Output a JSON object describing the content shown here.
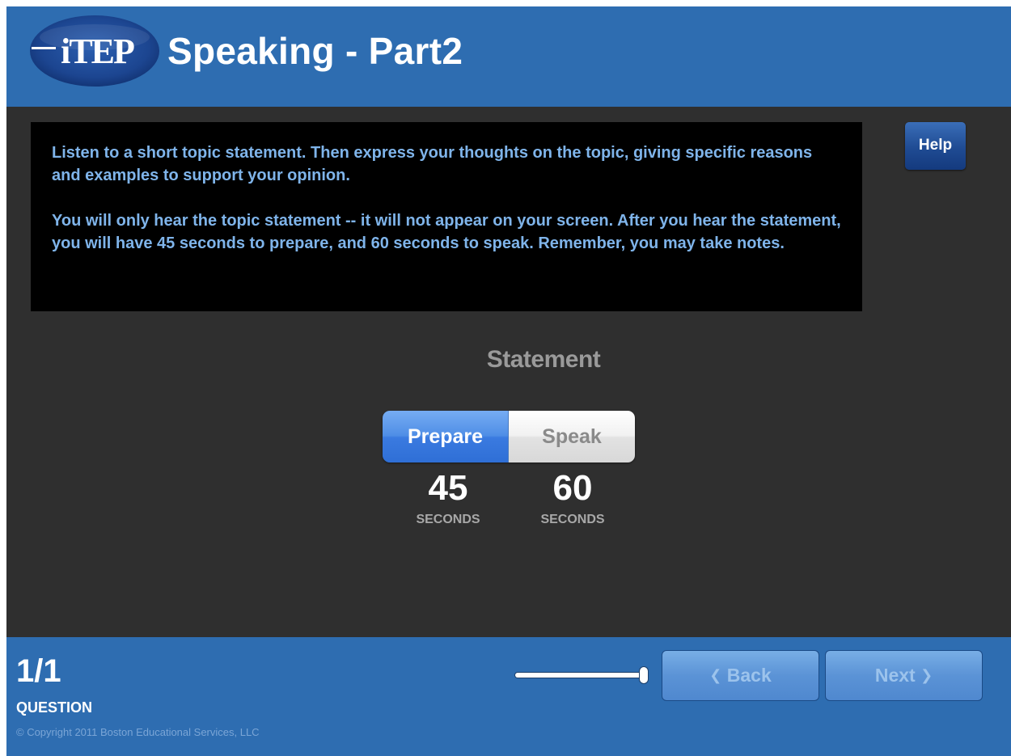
{
  "header": {
    "logo_text": "iTEP",
    "title": "Speaking - Part2"
  },
  "instructions": {
    "paragraph1": "Listen to a short topic statement.  Then express your thoughts on the topic, giving specific reasons and examples to support your opinion.",
    "paragraph2": "You will only hear the topic statement -- it will not appear on your screen.  After you hear the statement, you will have 45 seconds to prepare, and 60 seconds to speak.  Remember, you may take notes."
  },
  "help_button": {
    "label": "Help"
  },
  "statement": {
    "title": "Statement",
    "phases": [
      {
        "label": "Prepare",
        "value": "45",
        "unit": "SECONDS",
        "active": true
      },
      {
        "label": "Speak",
        "value": "60",
        "unit": "SECONDS",
        "active": false
      }
    ]
  },
  "footer": {
    "question_count": "1/1",
    "question_label": "QUESTION",
    "copyright": "© Copyright 2011 Boston Educational Services, LLC",
    "volume_level": 1.0,
    "back_button": {
      "label": "Back",
      "icon": "chevron-left-icon",
      "enabled": false
    },
    "next_button": {
      "label": "Next",
      "icon": "chevron-right-icon",
      "enabled": false
    }
  },
  "colors": {
    "brand_blue": "#2e6db1",
    "instruction_text": "#7fb4ea",
    "active_segment": "#4f8ee6",
    "background": "#2f2f2f"
  }
}
